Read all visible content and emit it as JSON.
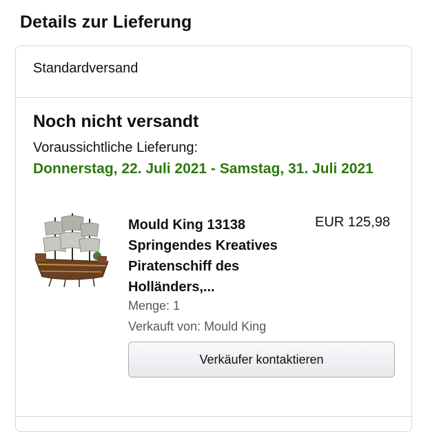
{
  "section_title": "Details zur Lieferung",
  "shipment": {
    "method": "Standardversand",
    "status": "Noch nicht versandt",
    "delivery_label": "Voraussichtliche Lieferung:",
    "delivery_date": "Donnerstag, 22. Juli 2021 - Samstag, 31. Juli 2021",
    "delivery_color": "#2b7a0b"
  },
  "item": {
    "title": "Mould King 13138 Springendes Kreatives Piratenschiff des Holländers,...",
    "price": "EUR 125,98",
    "quantity": "Menge: 1",
    "seller": "Verkauft von: Mould King",
    "image_icon": "pirate-ship-image"
  },
  "actions": {
    "contact_seller": "Verkäufer kontaktieren"
  }
}
